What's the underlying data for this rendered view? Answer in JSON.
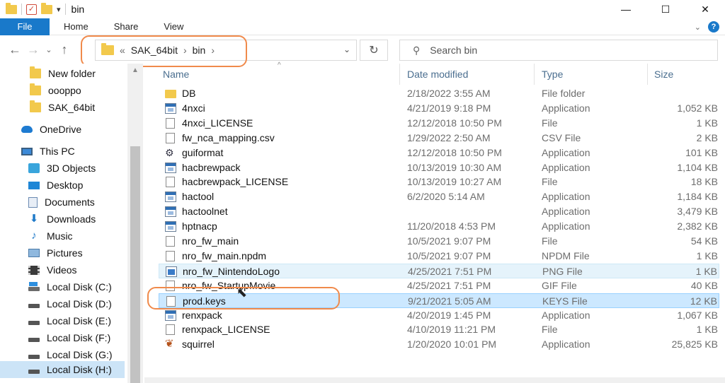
{
  "window": {
    "title": "bin",
    "controls": {
      "minimize": "—",
      "maximize": "☐",
      "close": "✕"
    }
  },
  "ribbon": {
    "file": "File",
    "tabs": [
      "Home",
      "Share",
      "View"
    ]
  },
  "address": {
    "prefix": "«",
    "crumbs": [
      "SAK_64bit",
      "bin"
    ],
    "separator": "›"
  },
  "search": {
    "placeholder": "Search bin"
  },
  "sidebar": {
    "quick_access": [
      "New folder",
      "oooppo",
      "SAK_64bit"
    ],
    "onedrive": "OneDrive",
    "this_pc": "This PC",
    "pc_items": [
      {
        "label": "3D Objects",
        "icon": "3d-objects-icon"
      },
      {
        "label": "Desktop",
        "icon": "desktop-icon"
      },
      {
        "label": "Documents",
        "icon": "documents-icon"
      },
      {
        "label": "Downloads",
        "icon": "downloads-icon"
      },
      {
        "label": "Music",
        "icon": "music-icon"
      },
      {
        "label": "Pictures",
        "icon": "pictures-icon"
      },
      {
        "label": "Videos",
        "icon": "videos-icon"
      },
      {
        "label": "Local Disk (C:)",
        "icon": "system-disk-icon"
      },
      {
        "label": "Local Disk (D:)",
        "icon": "disk-icon"
      },
      {
        "label": "Local Disk (E:)",
        "icon": "disk-icon"
      },
      {
        "label": "Local Disk (F:)",
        "icon": "disk-icon"
      },
      {
        "label": "Local Disk (G:)",
        "icon": "disk-icon"
      },
      {
        "label": "Local Disk (H:)",
        "icon": "disk-icon"
      }
    ],
    "selected": "Local Disk (H:)"
  },
  "columns": {
    "name": "Name",
    "date": "Date modified",
    "type": "Type",
    "size": "Size"
  },
  "files": [
    {
      "name": "DB",
      "date": "2/18/2022 3:55 AM",
      "type": "File folder",
      "size": "",
      "icon": "folder-icon"
    },
    {
      "name": "4nxci",
      "date": "4/21/2019 9:18 PM",
      "type": "Application",
      "size": "1,052 KB",
      "icon": "application-icon"
    },
    {
      "name": "4nxci_LICENSE",
      "date": "12/12/2018 10:50 PM",
      "type": "File",
      "size": "1 KB",
      "icon": "file-icon"
    },
    {
      "name": "fw_nca_mapping.csv",
      "date": "1/29/2022 2:50 AM",
      "type": "CSV File",
      "size": "2 KB",
      "icon": "file-icon"
    },
    {
      "name": "guiformat",
      "date": "12/12/2018 10:50 PM",
      "type": "Application",
      "size": "101 KB",
      "icon": "guiformat-icon"
    },
    {
      "name": "hacbrewpack",
      "date": "10/13/2019 10:30 AM",
      "type": "Application",
      "size": "1,104 KB",
      "icon": "application-icon"
    },
    {
      "name": "hacbrewpack_LICENSE",
      "date": "10/13/2019 10:27 AM",
      "type": "File",
      "size": "18 KB",
      "icon": "file-icon"
    },
    {
      "name": "hactool",
      "date": "6/2/2020 5:14 AM",
      "type": "Application",
      "size": "1,184 KB",
      "icon": "application-icon"
    },
    {
      "name": "hactoolnet",
      "date": "",
      "type": "Application",
      "size": "3,479 KB",
      "icon": "application-icon"
    },
    {
      "name": "hptnacp",
      "date": "11/20/2018 4:53 PM",
      "type": "Application",
      "size": "2,382 KB",
      "icon": "application-icon"
    },
    {
      "name": "nro_fw_main",
      "date": "10/5/2021 9:07 PM",
      "type": "File",
      "size": "54 KB",
      "icon": "file-icon"
    },
    {
      "name": "nro_fw_main.npdm",
      "date": "10/5/2021 9:07 PM",
      "type": "NPDM File",
      "size": "1 KB",
      "icon": "file-icon"
    },
    {
      "name": "nro_fw_NintendoLogo",
      "date": "4/25/2021 7:51 PM",
      "type": "PNG File",
      "size": "1 KB",
      "icon": "png-icon"
    },
    {
      "name": "nro_fw_StartupMovie",
      "date": "4/25/2021 7:51 PM",
      "type": "GIF File",
      "size": "40 KB",
      "icon": "file-icon"
    },
    {
      "name": "prod.keys",
      "date": "9/21/2021 5:05 AM",
      "type": "KEYS File",
      "size": "12 KB",
      "icon": "file-icon"
    },
    {
      "name": "renxpack",
      "date": "4/20/2019 1:45 PM",
      "type": "Application",
      "size": "1,067 KB",
      "icon": "application-icon"
    },
    {
      "name": "renxpack_LICENSE",
      "date": "4/10/2019 11:21 PM",
      "type": "File",
      "size": "1 KB",
      "icon": "file-icon"
    },
    {
      "name": "squirrel",
      "date": "1/20/2020 10:01 PM",
      "type": "Application",
      "size": "25,825 KB",
      "icon": "squirrel-icon"
    }
  ],
  "hovered_file": "nro_fw_NintendoLogo",
  "selected_file": "prod.keys",
  "colors": {
    "accent": "#1979ca",
    "highlight_circle": "#f08a4b",
    "selected_row": "#cce8ff"
  }
}
